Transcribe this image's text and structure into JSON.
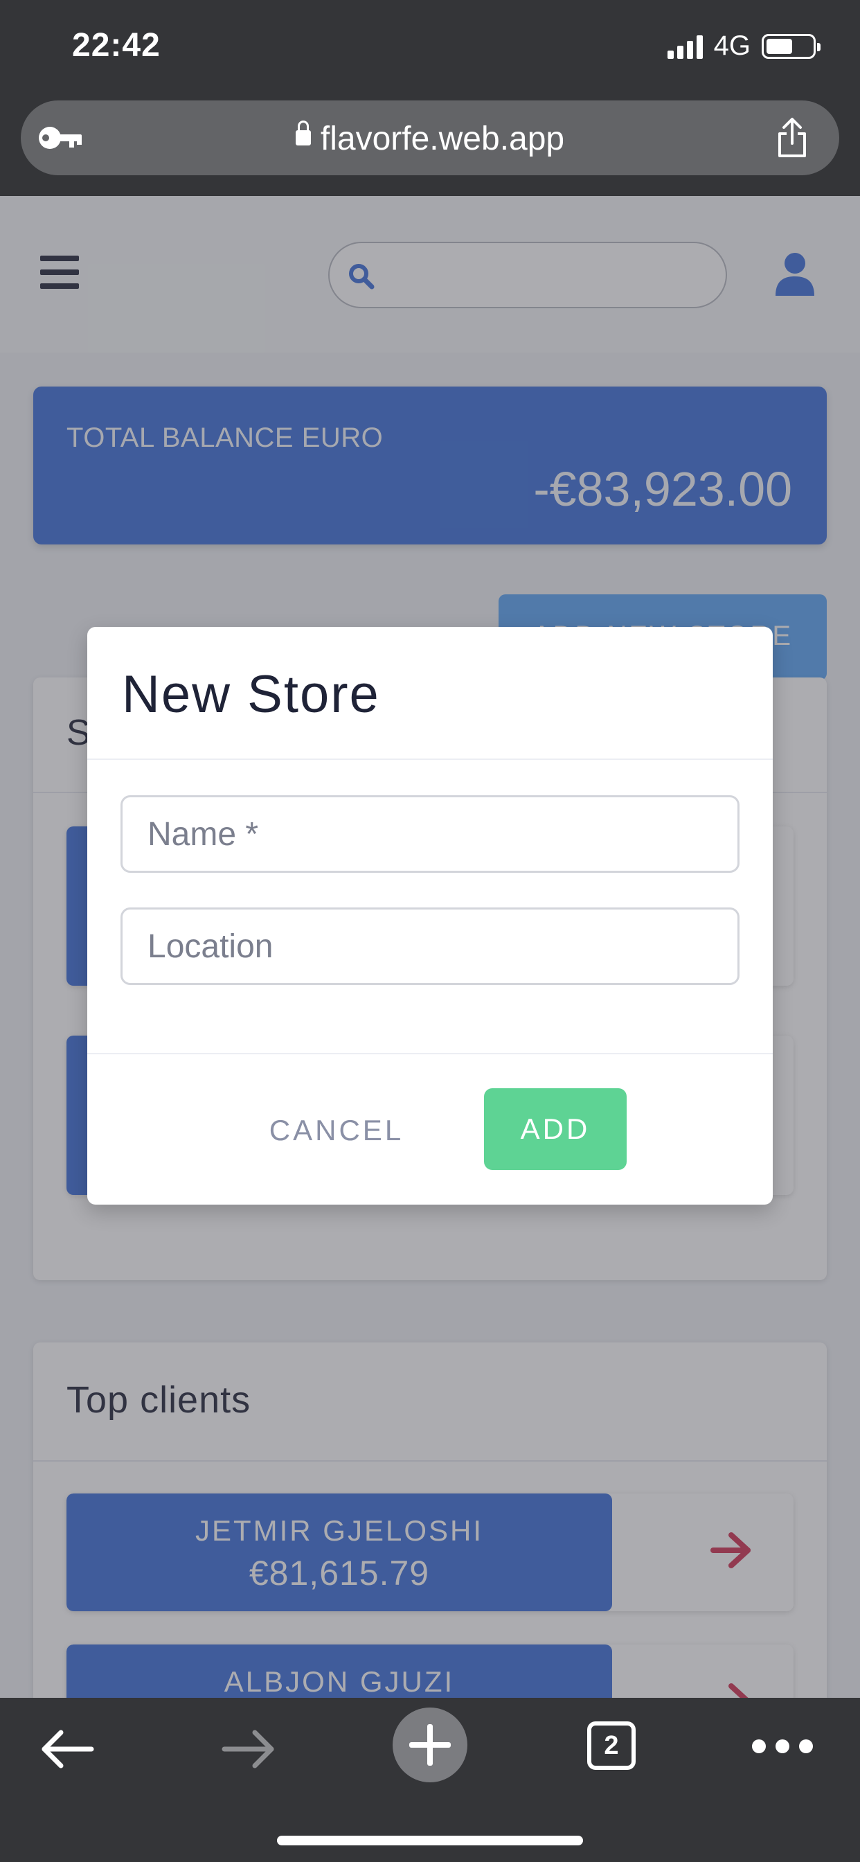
{
  "status_bar": {
    "time": "22:42",
    "network": "4G"
  },
  "browser": {
    "url": "flavorfe.web.app",
    "tab_count": "2"
  },
  "header": {
    "search_placeholder": ""
  },
  "balance": {
    "label": "TOTAL BALANCE EURO",
    "value": "-€83,923.00"
  },
  "stores": {
    "add_button_label": "ADD NEW STORE",
    "title_partial": "S"
  },
  "clients": {
    "title": "Top clients",
    "items": [
      {
        "name": "JETMIR GJELOSHI",
        "balance": "€81,615.79"
      },
      {
        "name": "ALBJON GJUZI",
        "balance": ""
      }
    ]
  },
  "modal": {
    "title": "New Store",
    "name_placeholder": "Name *",
    "location_placeholder": "Location",
    "cancel_label": "CANCEL",
    "add_label": "ADD"
  },
  "colors": {
    "primary_blue": "#3b6ed9",
    "add_green": "#5ed394",
    "arrow_red": "#d03050",
    "dark_bar": "#343538"
  },
  "icons": [
    "key-icon",
    "lock-icon",
    "share-icon",
    "menu-icon",
    "search-icon",
    "user-icon",
    "arrow-right-icon",
    "back-icon",
    "forward-icon",
    "new-tab-icon",
    "tabs-icon",
    "more-icon"
  ]
}
